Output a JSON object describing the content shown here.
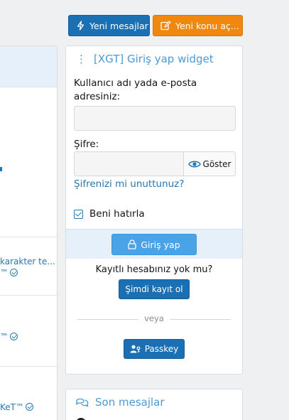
{
  "header": {
    "new_messages_label": "Yeni mesajlar",
    "new_topic_label": "Yeni konu aç..."
  },
  "left_list": {
    "row1_text": "karakter te...",
    "row1_author": "™",
    "row2_author": "™",
    "row3_author": "KeT™"
  },
  "login_widget": {
    "title": "[XGT] Giriş yap widget",
    "username_label": "Kullanıcı adı yada e-posta adresiniz:",
    "username_value": "",
    "password_label": "Şifre:",
    "password_value": "",
    "show_password_label": "Göster",
    "forgot_password_label": "Şifrenizi mi unuttunuz?",
    "remember_me_label": "Beni hatırla",
    "remember_me_checked": true,
    "login_button_label": "Giriş yap",
    "no_account_text": "Kayıtlı hesabınız yok mu?",
    "register_button_label": "Şimdi kayıt ol",
    "or_text": "veya",
    "passkey_button_label": "Passkey"
  },
  "latest_widget": {
    "title": "Son mesajlar"
  },
  "colors": {
    "primary": "#1b6fb3",
    "accent": "#f0880f",
    "link": "#2577b1",
    "title": "#4b9ad6",
    "login_button": "#4aa3e6",
    "page_bg": "#eef0f2"
  }
}
